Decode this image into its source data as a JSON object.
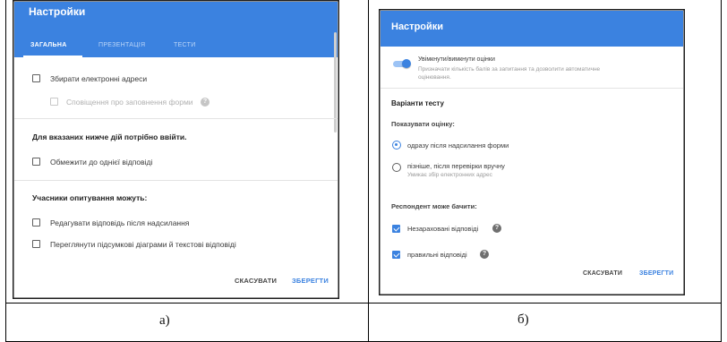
{
  "colors": {
    "accent": "#3b82e0",
    "header_bg": "#3b82e0"
  },
  "left": {
    "title": "Настройки",
    "tabs": [
      {
        "label": "ЗАГАЛЬНА",
        "active": true
      },
      {
        "label": "ПРЕЗЕНТАЦІЯ",
        "active": false
      },
      {
        "label": "ТЕСТИ",
        "active": false
      }
    ],
    "collect_emails": "Збирати електронні адреси",
    "response_receipts": "Сповіщення про заповнення форми",
    "signin_heading": "Для вказаних нижче дій потрібно ввійти.",
    "limit_one": "Обмежити до однієї відповіді",
    "respondents_heading": "Учасники опитування можуть:",
    "edit_after_submit": "Редагувати відповідь після надсилання",
    "see_summary": "Переглянути підсумкові діаграми й текстові відповіді",
    "cancel": "СКАСУВАТИ",
    "save": "ЗБЕРЕГТИ",
    "caption": "а)"
  },
  "right": {
    "title": "Настройки",
    "quiz_toggle_label": "Увімкнути/вимкнути оцінки",
    "quiz_toggle_desc_1": "Призначати кількість балів за запитання та дозволити автоматичне",
    "quiz_toggle_desc_2": "оцінювання.",
    "quiz_options_heading": "Варіанти тесту",
    "release_grade_heading": "Показувати оцінку:",
    "release_immediately": "одразу після надсилання форми",
    "release_later": "пізніше, після перевірки вручну",
    "release_later_note": "Умикає збір електронних адрес",
    "respondent_can_see": "Респондент може бачити:",
    "missed_questions": "Незараховані відповіді",
    "correct_answers": "правильні відповіді",
    "cancel": "СКАСУВАТИ",
    "save": "ЗБЕРЕГТИ",
    "caption": "б)"
  }
}
